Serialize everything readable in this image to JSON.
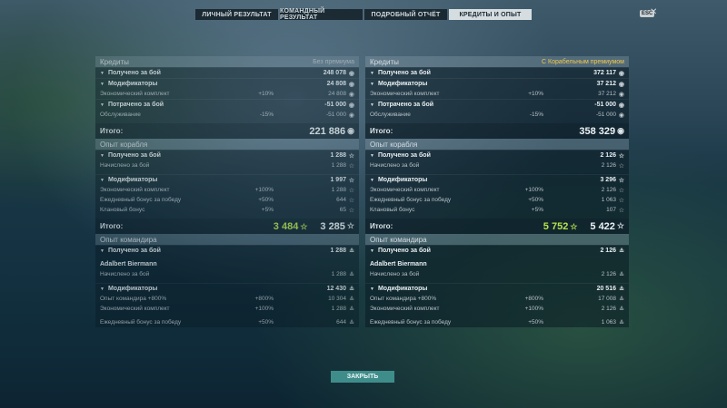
{
  "tabs": [
    "Личный результат",
    "Командный результат",
    "Подробный отчёт",
    "Кредиты и опыт"
  ],
  "esc_label": "ESC",
  "close_glyph": "✕",
  "left": {
    "credits_header": "Кредиты",
    "credits_note": "Без премиума",
    "earned_label": "Получено за бой",
    "earned_value": "248 078",
    "mods_label": "Модификаторы",
    "mods_value": "24 808",
    "eco_label": "Экономический комплект",
    "eco_pct": "+10%",
    "eco_value": "24 808",
    "spent_label": "Потрачено за бой",
    "spent_value": "-51 000",
    "service_label": "Обслуживание",
    "service_pct": "-15%",
    "service_value": "-51 000",
    "credits_total_label": "Итого:",
    "credits_total": "221 886",
    "ship_header": "Опыт корабля",
    "ship_earned_label": "Получено за бой",
    "ship_earned_value": "1 288",
    "ship_accrued_label": "Начислено за бой",
    "ship_accrued_value": "1 288",
    "ship_mods_label": "Модификаторы",
    "ship_mods_value": "1 997",
    "ship_eco_label": "Экономический комплект",
    "ship_eco_pct": "+100%",
    "ship_eco_value": "1 288",
    "ship_daily_label": "Ежедневный бонус за победу",
    "ship_daily_pct": "+50%",
    "ship_daily_value": "644",
    "ship_clan_label": "Клановый бонус",
    "ship_clan_pct": "+5%",
    "ship_clan_value": "65",
    "ship_total_label": "Итого:",
    "ship_total_green": "3 484",
    "ship_total": "3 285",
    "cmd_header": "Опыт командира",
    "cmd_earned_label": "Получено за бой",
    "cmd_earned_value": "1 288",
    "cmd_name": "Adalbert Biermann",
    "cmd_accrued_label": "Начислено за бой",
    "cmd_accrued_value": "1 288",
    "cmd_mods_label": "Модификаторы",
    "cmd_mods_value": "12 430",
    "cmd_exp_label": "Опыт командира +800%",
    "cmd_exp_pct": "+800%",
    "cmd_exp_value": "10 304",
    "cmd_eco_label": "Экономический комплект",
    "cmd_eco_pct": "+100%",
    "cmd_eco_value": "1 288",
    "cmd_daily_label": "Ежедневный бонус за победу",
    "cmd_daily_pct": "+50%",
    "cmd_daily_value": "644"
  },
  "right": {
    "credits_header": "Кредиты",
    "credits_note": "С Корабельным премиумом",
    "earned_label": "Получено за бой",
    "earned_value": "372 117",
    "mods_label": "Модификаторы",
    "mods_value": "37 212",
    "eco_label": "Экономический комплект",
    "eco_pct": "+10%",
    "eco_value": "37 212",
    "spent_label": "Потрачено за бой",
    "spent_value": "-51 000",
    "service_label": "Обслуживание",
    "service_pct": "-15%",
    "service_value": "-51 000",
    "credits_total_label": "Итого:",
    "credits_total": "358 329",
    "ship_header": "Опыт корабля",
    "ship_earned_label": "Получено за бой",
    "ship_earned_value": "2 126",
    "ship_accrued_label": "Начислено за бой",
    "ship_accrued_value": "2 126",
    "ship_mods_label": "Модификаторы",
    "ship_mods_value": "3 296",
    "ship_eco_label": "Экономический комплект",
    "ship_eco_pct": "+100%",
    "ship_eco_value": "2 126",
    "ship_daily_label": "Ежедневный бонус за победу",
    "ship_daily_pct": "+50%",
    "ship_daily_value": "1 063",
    "ship_clan_label": "Клановый бонус",
    "ship_clan_pct": "+5%",
    "ship_clan_value": "107",
    "ship_total_label": "Итого:",
    "ship_total_green": "5 752",
    "ship_total": "5 422",
    "cmd_header": "Опыт командира",
    "cmd_earned_label": "Получено за бой",
    "cmd_earned_value": "2 126",
    "cmd_name": "Adalbert Biermann",
    "cmd_accrued_label": "Начислено за бой",
    "cmd_accrued_value": "2 126",
    "cmd_mods_label": "Модификаторы",
    "cmd_mods_value": "20 516",
    "cmd_exp_label": "Опыт командира +800%",
    "cmd_exp_pct": "+800%",
    "cmd_exp_value": "17 008",
    "cmd_eco_label": "Экономический комплект",
    "cmd_eco_pct": "+100%",
    "cmd_eco_value": "2 126",
    "cmd_daily_label": "Ежедневный бонус за победу",
    "cmd_daily_pct": "+50%",
    "cmd_daily_value": "1 063"
  },
  "close_button": "Закрыть",
  "colors": {
    "accent_green": "#b5e24f",
    "premium_gold": "#f2c94c",
    "button_teal": "#3f8d8b"
  }
}
